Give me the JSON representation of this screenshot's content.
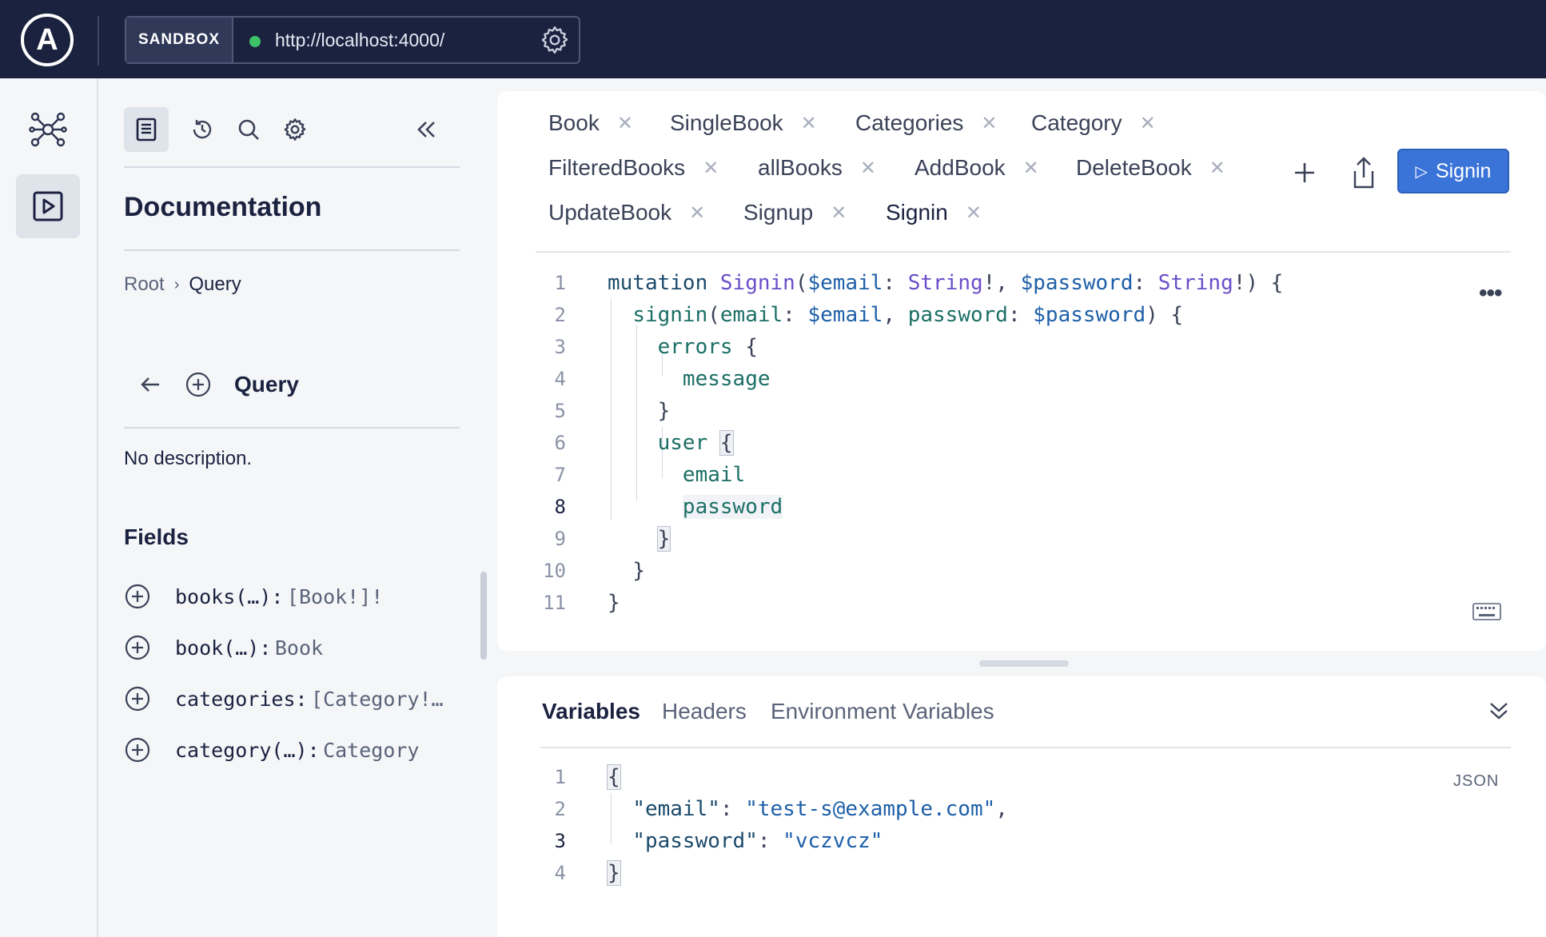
{
  "topbar": {
    "logo_letter": "A",
    "mode_label": "SANDBOX",
    "endpoint_url": "http://localhost:4000/"
  },
  "docs": {
    "title": "Documentation",
    "breadcrumb": [
      "Root",
      "Query"
    ],
    "query_title": "Query",
    "description": "No description.",
    "fields_title": "Fields",
    "fields": [
      {
        "name": "books(…):",
        "type": "[Book!]!"
      },
      {
        "name": "book(…):",
        "type": "Book"
      },
      {
        "name": "categories:",
        "type": "[Category!…"
      },
      {
        "name": "category(…):",
        "type": "Category"
      }
    ]
  },
  "operation": {
    "tabs": [
      [
        "Book",
        "SingleBook",
        "Categories",
        "Category"
      ],
      [
        "FilteredBooks",
        "allBooks",
        "AddBook",
        "DeleteBook"
      ],
      [
        "UpdateBook",
        "Signup",
        "Signin"
      ]
    ],
    "active_tab": "Signin",
    "run_button": "Signin",
    "current_line": 8,
    "line_numbers": [
      "1",
      "2",
      "3",
      "4",
      "5",
      "6",
      "7",
      "8",
      "9",
      "10",
      "11"
    ]
  },
  "variables": {
    "tabs": [
      "Variables",
      "Headers",
      "Environment Variables"
    ],
    "active_tab": "Variables",
    "format_label": "JSON",
    "line_numbers": [
      "1",
      "2",
      "3",
      "4"
    ],
    "email_key": "\"email\"",
    "email_value": "\"test-s@example.com\"",
    "password_key": "\"password\"",
    "password_value": "\"vczvcz\""
  },
  "colors": {
    "topbar_bg": "#1b2240",
    "run_button": "#3b74d8",
    "status_dot": "#3ec267"
  },
  "icons": [
    "logo-icon",
    "gear-icon",
    "graph-icon",
    "explorer-play-icon",
    "docs-icon",
    "history-icon",
    "search-icon",
    "settings-icon",
    "collapse-left-icon",
    "back-arrow-icon",
    "add-circle-icon",
    "close-icon",
    "plus-icon",
    "share-icon",
    "play-icon",
    "more-icon",
    "keyboard-icon",
    "chevron-double-down-icon"
  ]
}
